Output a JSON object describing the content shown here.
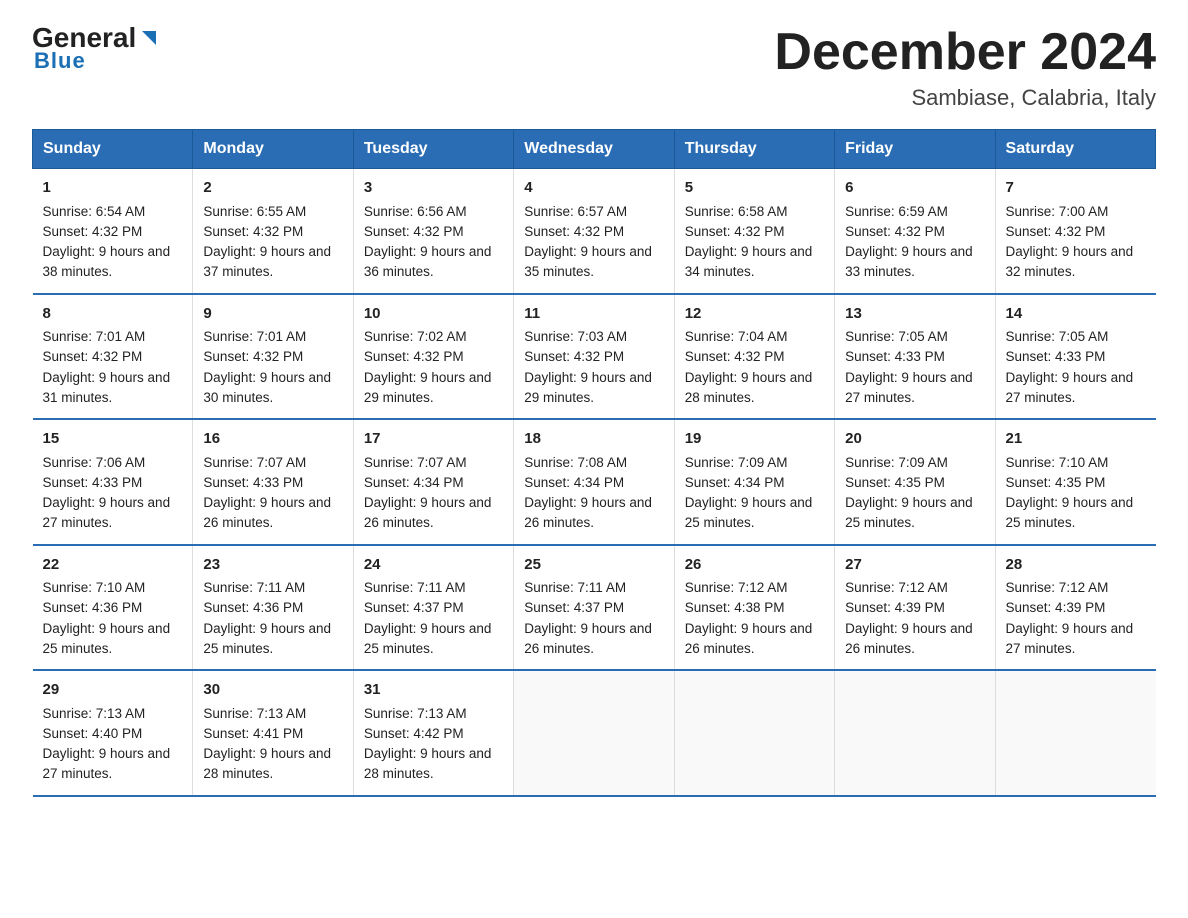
{
  "header": {
    "logo_general": "General",
    "logo_blue": "Blue",
    "title": "December 2024",
    "subtitle": "Sambiase, Calabria, Italy"
  },
  "days_of_week": [
    "Sunday",
    "Monday",
    "Tuesday",
    "Wednesday",
    "Thursday",
    "Friday",
    "Saturday"
  ],
  "weeks": [
    [
      {
        "day": "1",
        "sunrise": "6:54 AM",
        "sunset": "4:32 PM",
        "daylight": "9 hours and 38 minutes."
      },
      {
        "day": "2",
        "sunrise": "6:55 AM",
        "sunset": "4:32 PM",
        "daylight": "9 hours and 37 minutes."
      },
      {
        "day": "3",
        "sunrise": "6:56 AM",
        "sunset": "4:32 PM",
        "daylight": "9 hours and 36 minutes."
      },
      {
        "day": "4",
        "sunrise": "6:57 AM",
        "sunset": "4:32 PM",
        "daylight": "9 hours and 35 minutes."
      },
      {
        "day": "5",
        "sunrise": "6:58 AM",
        "sunset": "4:32 PM",
        "daylight": "9 hours and 34 minutes."
      },
      {
        "day": "6",
        "sunrise": "6:59 AM",
        "sunset": "4:32 PM",
        "daylight": "9 hours and 33 minutes."
      },
      {
        "day": "7",
        "sunrise": "7:00 AM",
        "sunset": "4:32 PM",
        "daylight": "9 hours and 32 minutes."
      }
    ],
    [
      {
        "day": "8",
        "sunrise": "7:01 AM",
        "sunset": "4:32 PM",
        "daylight": "9 hours and 31 minutes."
      },
      {
        "day": "9",
        "sunrise": "7:01 AM",
        "sunset": "4:32 PM",
        "daylight": "9 hours and 30 minutes."
      },
      {
        "day": "10",
        "sunrise": "7:02 AM",
        "sunset": "4:32 PM",
        "daylight": "9 hours and 29 minutes."
      },
      {
        "day": "11",
        "sunrise": "7:03 AM",
        "sunset": "4:32 PM",
        "daylight": "9 hours and 29 minutes."
      },
      {
        "day": "12",
        "sunrise": "7:04 AM",
        "sunset": "4:32 PM",
        "daylight": "9 hours and 28 minutes."
      },
      {
        "day": "13",
        "sunrise": "7:05 AM",
        "sunset": "4:33 PM",
        "daylight": "9 hours and 27 minutes."
      },
      {
        "day": "14",
        "sunrise": "7:05 AM",
        "sunset": "4:33 PM",
        "daylight": "9 hours and 27 minutes."
      }
    ],
    [
      {
        "day": "15",
        "sunrise": "7:06 AM",
        "sunset": "4:33 PM",
        "daylight": "9 hours and 27 minutes."
      },
      {
        "day": "16",
        "sunrise": "7:07 AM",
        "sunset": "4:33 PM",
        "daylight": "9 hours and 26 minutes."
      },
      {
        "day": "17",
        "sunrise": "7:07 AM",
        "sunset": "4:34 PM",
        "daylight": "9 hours and 26 minutes."
      },
      {
        "day": "18",
        "sunrise": "7:08 AM",
        "sunset": "4:34 PM",
        "daylight": "9 hours and 26 minutes."
      },
      {
        "day": "19",
        "sunrise": "7:09 AM",
        "sunset": "4:34 PM",
        "daylight": "9 hours and 25 minutes."
      },
      {
        "day": "20",
        "sunrise": "7:09 AM",
        "sunset": "4:35 PM",
        "daylight": "9 hours and 25 minutes."
      },
      {
        "day": "21",
        "sunrise": "7:10 AM",
        "sunset": "4:35 PM",
        "daylight": "9 hours and 25 minutes."
      }
    ],
    [
      {
        "day": "22",
        "sunrise": "7:10 AM",
        "sunset": "4:36 PM",
        "daylight": "9 hours and 25 minutes."
      },
      {
        "day": "23",
        "sunrise": "7:11 AM",
        "sunset": "4:36 PM",
        "daylight": "9 hours and 25 minutes."
      },
      {
        "day": "24",
        "sunrise": "7:11 AM",
        "sunset": "4:37 PM",
        "daylight": "9 hours and 25 minutes."
      },
      {
        "day": "25",
        "sunrise": "7:11 AM",
        "sunset": "4:37 PM",
        "daylight": "9 hours and 26 minutes."
      },
      {
        "day": "26",
        "sunrise": "7:12 AM",
        "sunset": "4:38 PM",
        "daylight": "9 hours and 26 minutes."
      },
      {
        "day": "27",
        "sunrise": "7:12 AM",
        "sunset": "4:39 PM",
        "daylight": "9 hours and 26 minutes."
      },
      {
        "day": "28",
        "sunrise": "7:12 AM",
        "sunset": "4:39 PM",
        "daylight": "9 hours and 27 minutes."
      }
    ],
    [
      {
        "day": "29",
        "sunrise": "7:13 AM",
        "sunset": "4:40 PM",
        "daylight": "9 hours and 27 minutes."
      },
      {
        "day": "30",
        "sunrise": "7:13 AM",
        "sunset": "4:41 PM",
        "daylight": "9 hours and 28 minutes."
      },
      {
        "day": "31",
        "sunrise": "7:13 AM",
        "sunset": "4:42 PM",
        "daylight": "9 hours and 28 minutes."
      },
      null,
      null,
      null,
      null
    ]
  ]
}
